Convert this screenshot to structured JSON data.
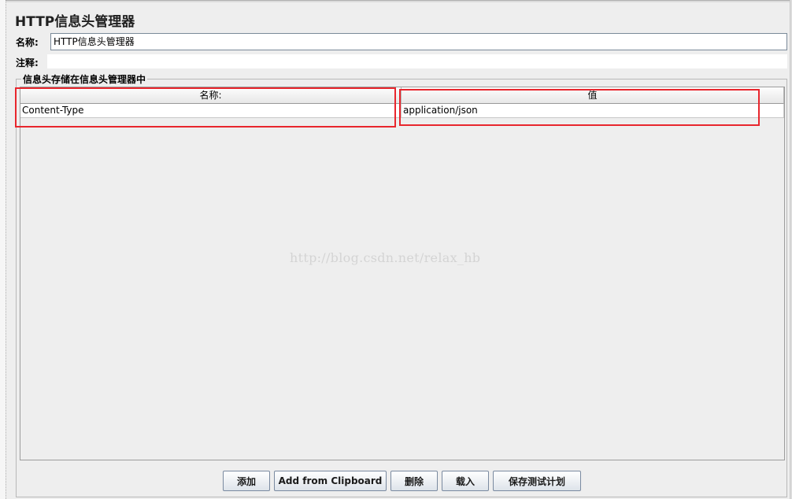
{
  "panel": {
    "title": "HTTP信息头管理器"
  },
  "form": {
    "name_label": "名称:",
    "name_value": "HTTP信息头管理器",
    "comment_label": "注释:",
    "comment_value": ""
  },
  "headers_group": {
    "legend": "信息头存储在信息头管理器中",
    "columns": [
      "名称:",
      "值"
    ],
    "rows": [
      {
        "name": "Content-Type",
        "value": "application/json"
      }
    ]
  },
  "watermark": "http://blog.csdn.net/relax_hb",
  "buttons": {
    "add": "添加",
    "add_from_clipboard": "Add from Clipboard",
    "delete": "删除",
    "load": "载入",
    "save_test_plan": "保存测试计划"
  },
  "colors": {
    "highlight": "#e8262d",
    "background": "#eeeeee"
  }
}
